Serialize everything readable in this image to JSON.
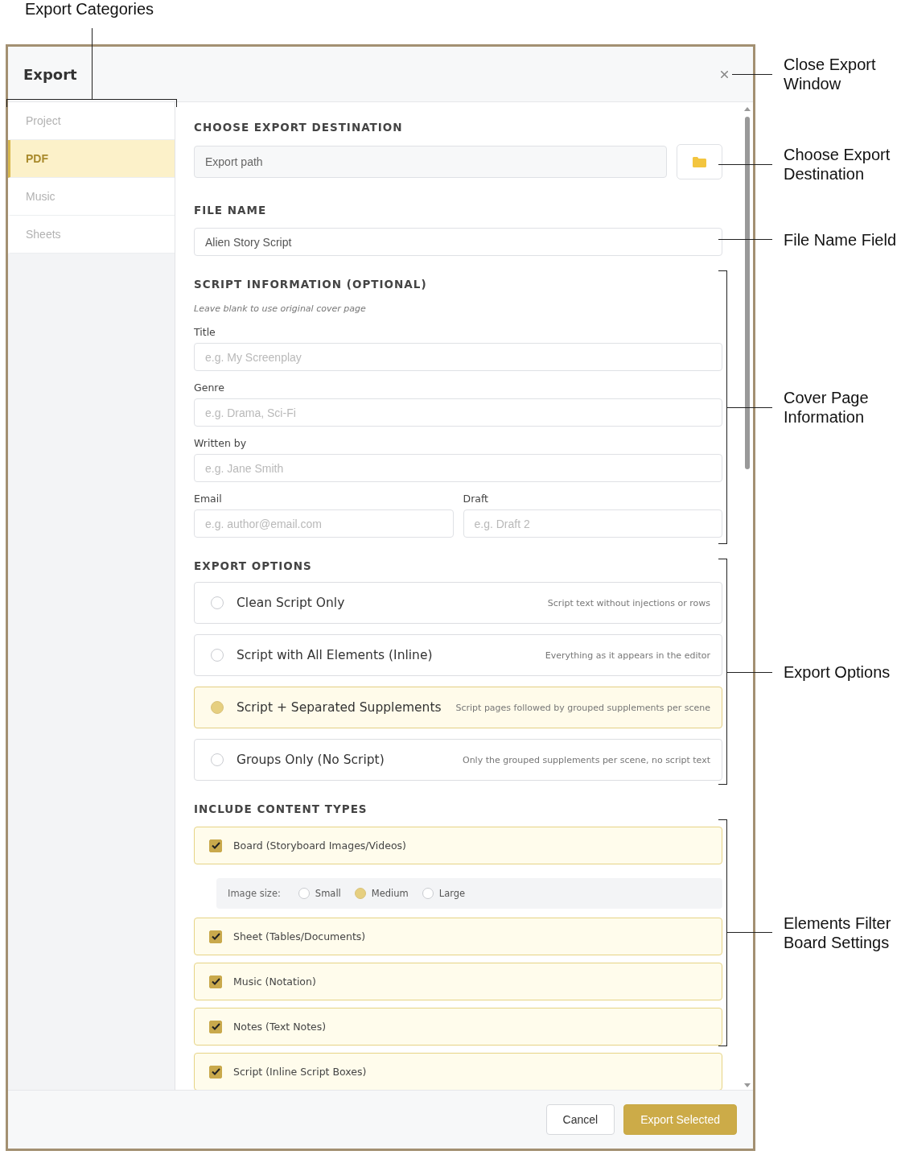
{
  "window": {
    "title": "Export"
  },
  "sidebar": {
    "items": [
      {
        "label": "Project",
        "selected": false
      },
      {
        "label": "PDF",
        "selected": true
      },
      {
        "label": "Music",
        "selected": false
      },
      {
        "label": "Sheets",
        "selected": false
      }
    ]
  },
  "destination": {
    "heading": "CHOOSE EXPORT DESTINATION",
    "placeholder": "Export path"
  },
  "file_name": {
    "heading": "FILE NAME",
    "value": "Alien Story Script"
  },
  "script_info": {
    "heading": "SCRIPT INFORMATION (OPTIONAL)",
    "hint": "Leave blank to use original cover page",
    "rows": [
      [
        {
          "label": "Title",
          "placeholder": "e.g. My Screenplay"
        }
      ],
      [
        {
          "label": "Genre",
          "placeholder": "e.g. Drama, Sci-Fi"
        }
      ],
      [
        {
          "label": "Written by",
          "placeholder": "e.g. Jane Smith"
        }
      ],
      [
        {
          "label": "Email",
          "placeholder": "e.g. author@email.com"
        },
        {
          "label": "Draft",
          "placeholder": "e.g. Draft 2"
        }
      ]
    ]
  },
  "export_options": {
    "heading": "EXPORT OPTIONS",
    "options": [
      {
        "label": "Clean Script Only",
        "description": "Script text without injections or rows",
        "selected": false
      },
      {
        "label": "Script with All Elements (Inline)",
        "description": "Everything as it appears in the editor",
        "selected": false
      },
      {
        "label": "Script + Separated Supplements",
        "description": "Script pages followed by grouped supplements per scene",
        "selected": true
      },
      {
        "label": "Groups Only (No Script)",
        "description": "Only the grouped supplements per scene, no script text",
        "selected": false
      }
    ]
  },
  "content_types": {
    "heading": "INCLUDE CONTENT TYPES",
    "items": [
      {
        "kind": "checkbox",
        "label": "Board (Storyboard Images/Videos)",
        "checked": true
      },
      {
        "kind": "image_size",
        "label": "Image size:",
        "options": [
          {
            "label": "Small",
            "selected": false
          },
          {
            "label": "Medium",
            "selected": true
          },
          {
            "label": "Large",
            "selected": false
          }
        ]
      },
      {
        "kind": "checkbox",
        "label": "Sheet (Tables/Documents)",
        "checked": true
      },
      {
        "kind": "checkbox",
        "label": "Music (Notation)",
        "checked": true
      },
      {
        "kind": "checkbox",
        "label": "Notes (Text Notes)",
        "checked": true
      },
      {
        "kind": "checkbox",
        "label": "Script (Inline Script Boxes)",
        "checked": true
      }
    ]
  },
  "footer": {
    "buttons": [
      {
        "label": "Cancel",
        "kind": "secondary"
      },
      {
        "label": "Export Selected",
        "kind": "primary"
      }
    ]
  },
  "callouts": {
    "top": "Export Categories",
    "right": [
      "Close Export\nWindow",
      "Choose Export\nDestination",
      "File Name Field",
      "Cover Page\nInformation",
      "Export Options",
      "Elements Filter\nBoard Settings"
    ]
  }
}
